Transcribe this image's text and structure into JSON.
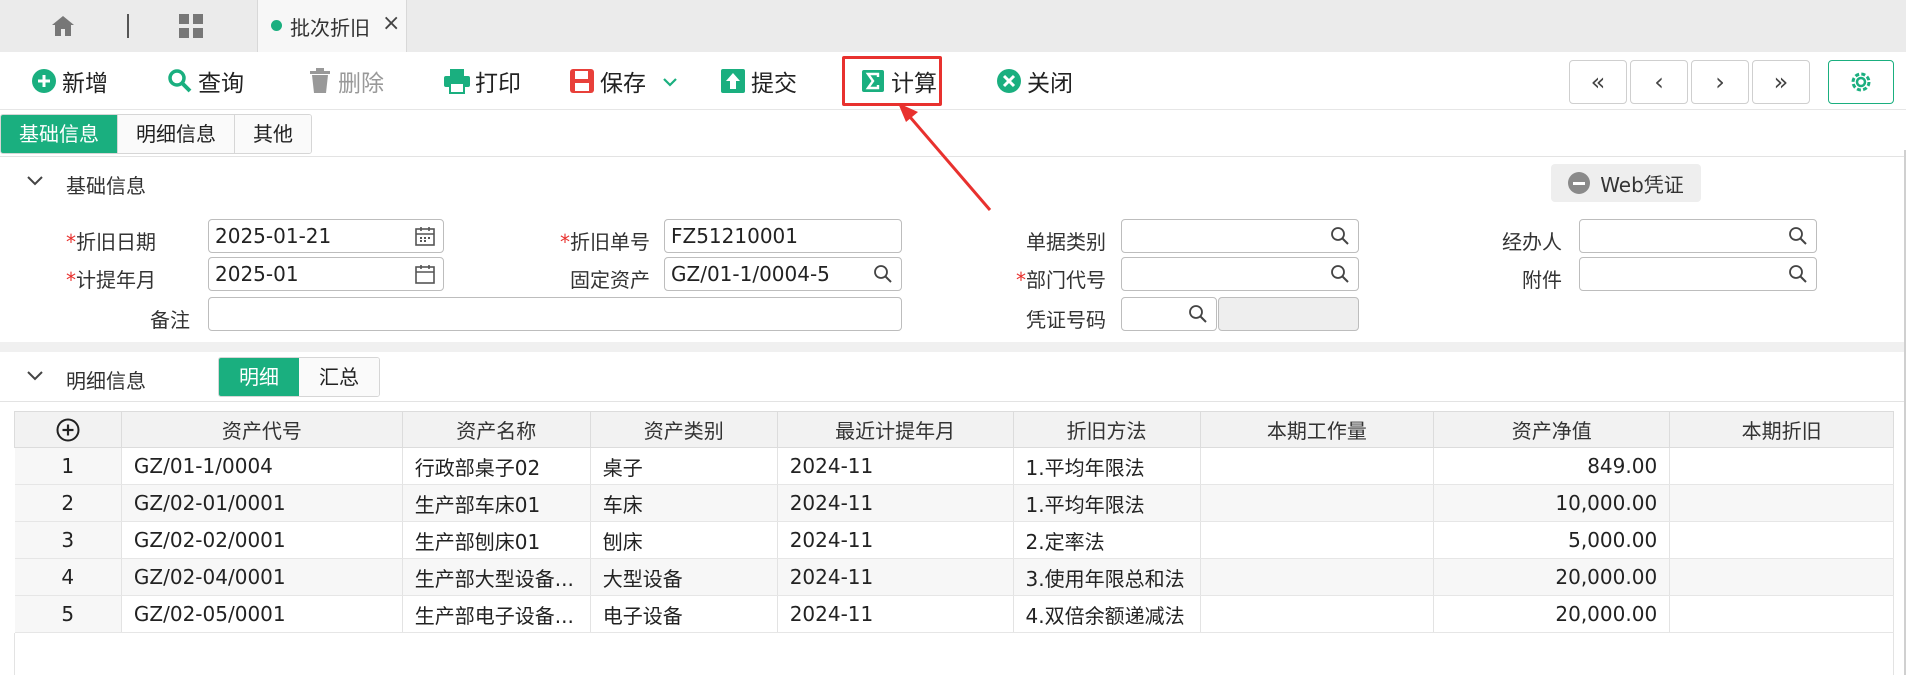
{
  "tabstrip": {
    "active_tab": "批次折旧",
    "close": "×"
  },
  "toolbar": {
    "add": "新增",
    "query": "查询",
    "delete": "删除",
    "print": "打印",
    "save": "保存",
    "submit": "提交",
    "calc": "计算",
    "close": "关闭"
  },
  "nav": {
    "first": "«",
    "prev": "‹",
    "next": "›",
    "last": "»"
  },
  "tabs": [
    "基础信息",
    "明细信息",
    "其他"
  ],
  "basic": {
    "title": "基础信息",
    "web_voucher": "Web凭证",
    "labels": {
      "dep_date": "折旧日期",
      "dep_no": "折旧单号",
      "doc_type": "单据类别",
      "handler": "经办人",
      "accrual_month": "计提年月",
      "fixed_asset": "固定资产",
      "dept_code": "部门代号",
      "attachment": "附件",
      "remark": "备注",
      "voucher_no": "凭证号码"
    },
    "values": {
      "dep_date": "2025-01-21",
      "dep_no": "FZ51210001",
      "accrual_month": "2025-01",
      "fixed_asset": "GZ/01-1/0004-5",
      "doc_type": "",
      "handler": "",
      "dept_code": "",
      "attachment": "",
      "remark": "",
      "voucher_no": ""
    }
  },
  "detail": {
    "title": "明细信息",
    "subtabs": [
      "明细",
      "汇总"
    ],
    "columns": [
      "资产代号",
      "资产名称",
      "资产类别",
      "最近计提年月",
      "折旧方法",
      "本期工作量",
      "资产净值",
      "本期折旧"
    ],
    "rows": [
      [
        "1",
        "GZ/01-1/0004",
        "行政部桌子02",
        "桌子",
        "2024-11",
        "1.平均年限法",
        "",
        "849.00",
        ""
      ],
      [
        "2",
        "GZ/02-01/0001",
        "生产部车床01",
        "车床",
        "2024-11",
        "1.平均年限法",
        "",
        "10,000.00",
        ""
      ],
      [
        "3",
        "GZ/02-02/0001",
        "生产部刨床01",
        "刨床",
        "2024-11",
        "2.定率法",
        "",
        "5,000.00",
        ""
      ],
      [
        "4",
        "GZ/02-04/0001",
        "生产部大型设备...",
        "大型设备",
        "2024-11",
        "3.使用年限总和法",
        "",
        "20,000.00",
        ""
      ],
      [
        "5",
        "GZ/02-05/0001",
        "生产部电子设备...",
        "电子设备",
        "2024-11",
        "4.双倍余额递减法",
        "",
        "20,000.00",
        ""
      ]
    ]
  },
  "colors": {
    "accent": "#1aaf7f",
    "highlight": "#e8312e",
    "required": "#e8312e"
  }
}
